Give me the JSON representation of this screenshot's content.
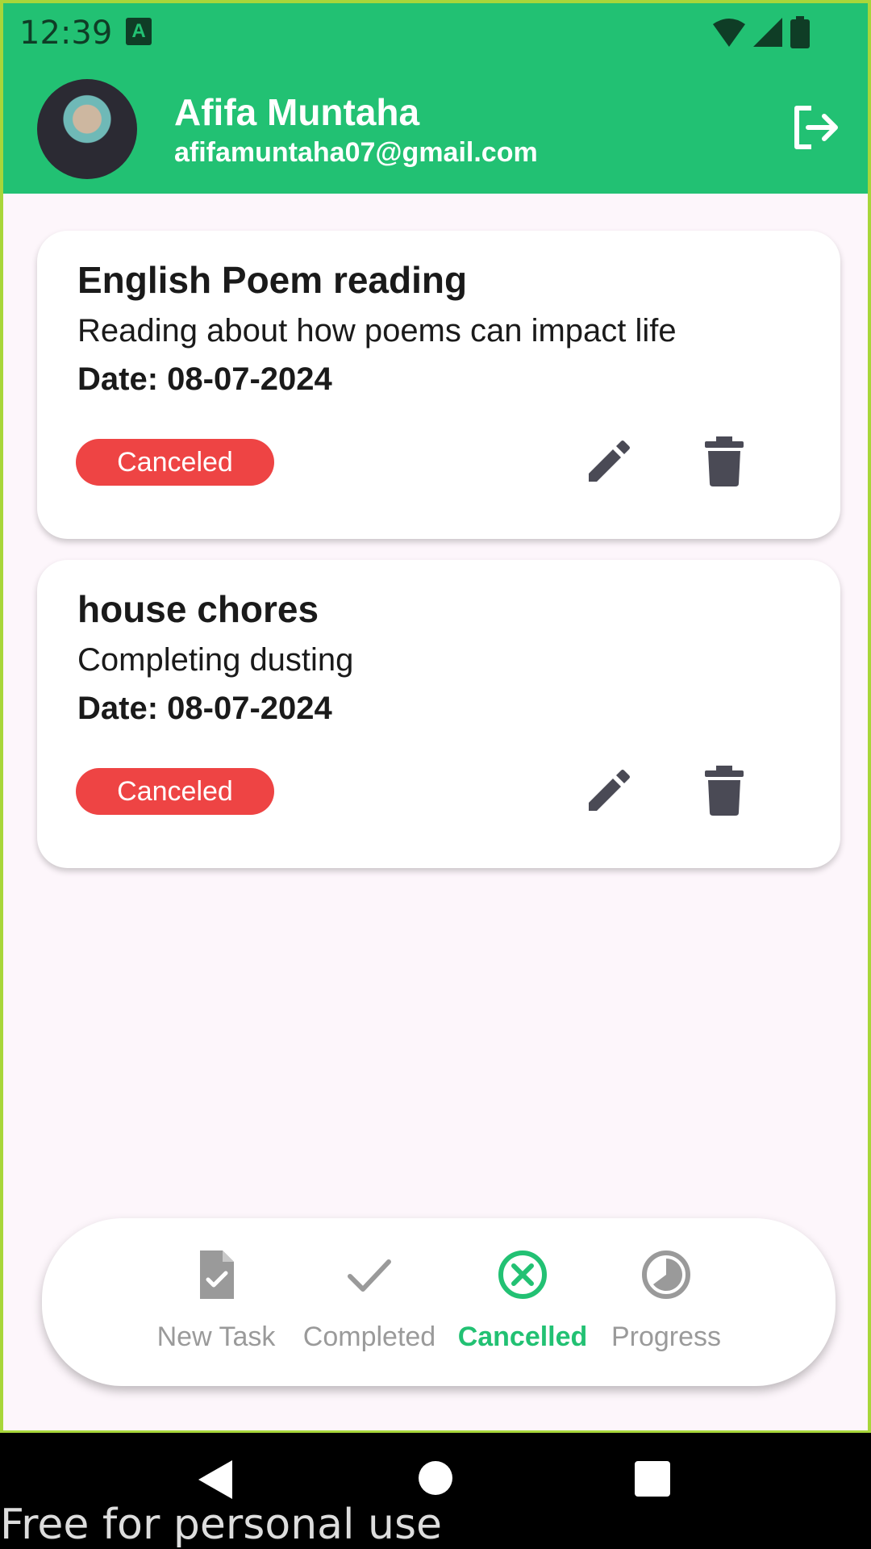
{
  "status_bar": {
    "time": "12:39",
    "app_icon_letter": "A"
  },
  "header": {
    "name": "Afifa Muntaha",
    "email": "afifamuntaha07@gmail.com"
  },
  "tasks": [
    {
      "title": "English Poem reading",
      "description": "Reading about how poems can impact life",
      "date": "Date: 08-07-2024",
      "status": "Canceled"
    },
    {
      "title": "house chores",
      "description": "Completing dusting",
      "date": "Date: 08-07-2024",
      "status": "Canceled"
    }
  ],
  "bottom_nav": {
    "items": [
      {
        "label": "New Task",
        "icon": "task-doc-icon"
      },
      {
        "label": "Completed",
        "icon": "check-icon"
      },
      {
        "label": "Cancelled",
        "icon": "cancel-circle-icon",
        "active": true
      },
      {
        "label": "Progress",
        "icon": "progress-icon"
      }
    ]
  },
  "watermark": "Free for personal use",
  "colors": {
    "primary": "#22c173",
    "badge": "#ee4444",
    "inactive": "#9a9a9a"
  }
}
